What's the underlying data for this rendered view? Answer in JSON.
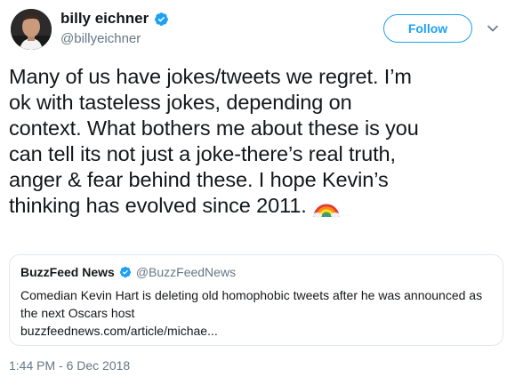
{
  "author": {
    "name": "billy eichner",
    "handle": "@billyeichner",
    "verified_icon": "verified-badge-icon",
    "accent_color": "#1da1f2"
  },
  "actions": {
    "follow_label": "Follow",
    "menu_icon": "chevron-down-icon"
  },
  "tweet": {
    "lines": [
      "Many of us have jokes/tweets we regret. I’m",
      "ok with tasteless jokes, depending on",
      "context. What bothers me about these is you",
      "can tell its not just a joke-there’s real truth,",
      "anger & fear behind these. I hope Kevin’s",
      "thinking has evolved since 2011."
    ],
    "emoji_icon": "rainbow-icon"
  },
  "quoted_tweet": {
    "name": "BuzzFeed News",
    "handle": "@BuzzFeedNews",
    "lines": [
      "Comedian Kevin Hart is deleting old homophobic tweets after he was announced as",
      "the next Oscars host",
      "buzzfeednews.com/article/michae..."
    ]
  },
  "timestamp": "1:44 PM - 6 Dec 2018",
  "colors": {
    "text": "#14171a",
    "secondary_text": "#657786",
    "border": "#e1e8ed",
    "accent": "#1da1f2"
  }
}
